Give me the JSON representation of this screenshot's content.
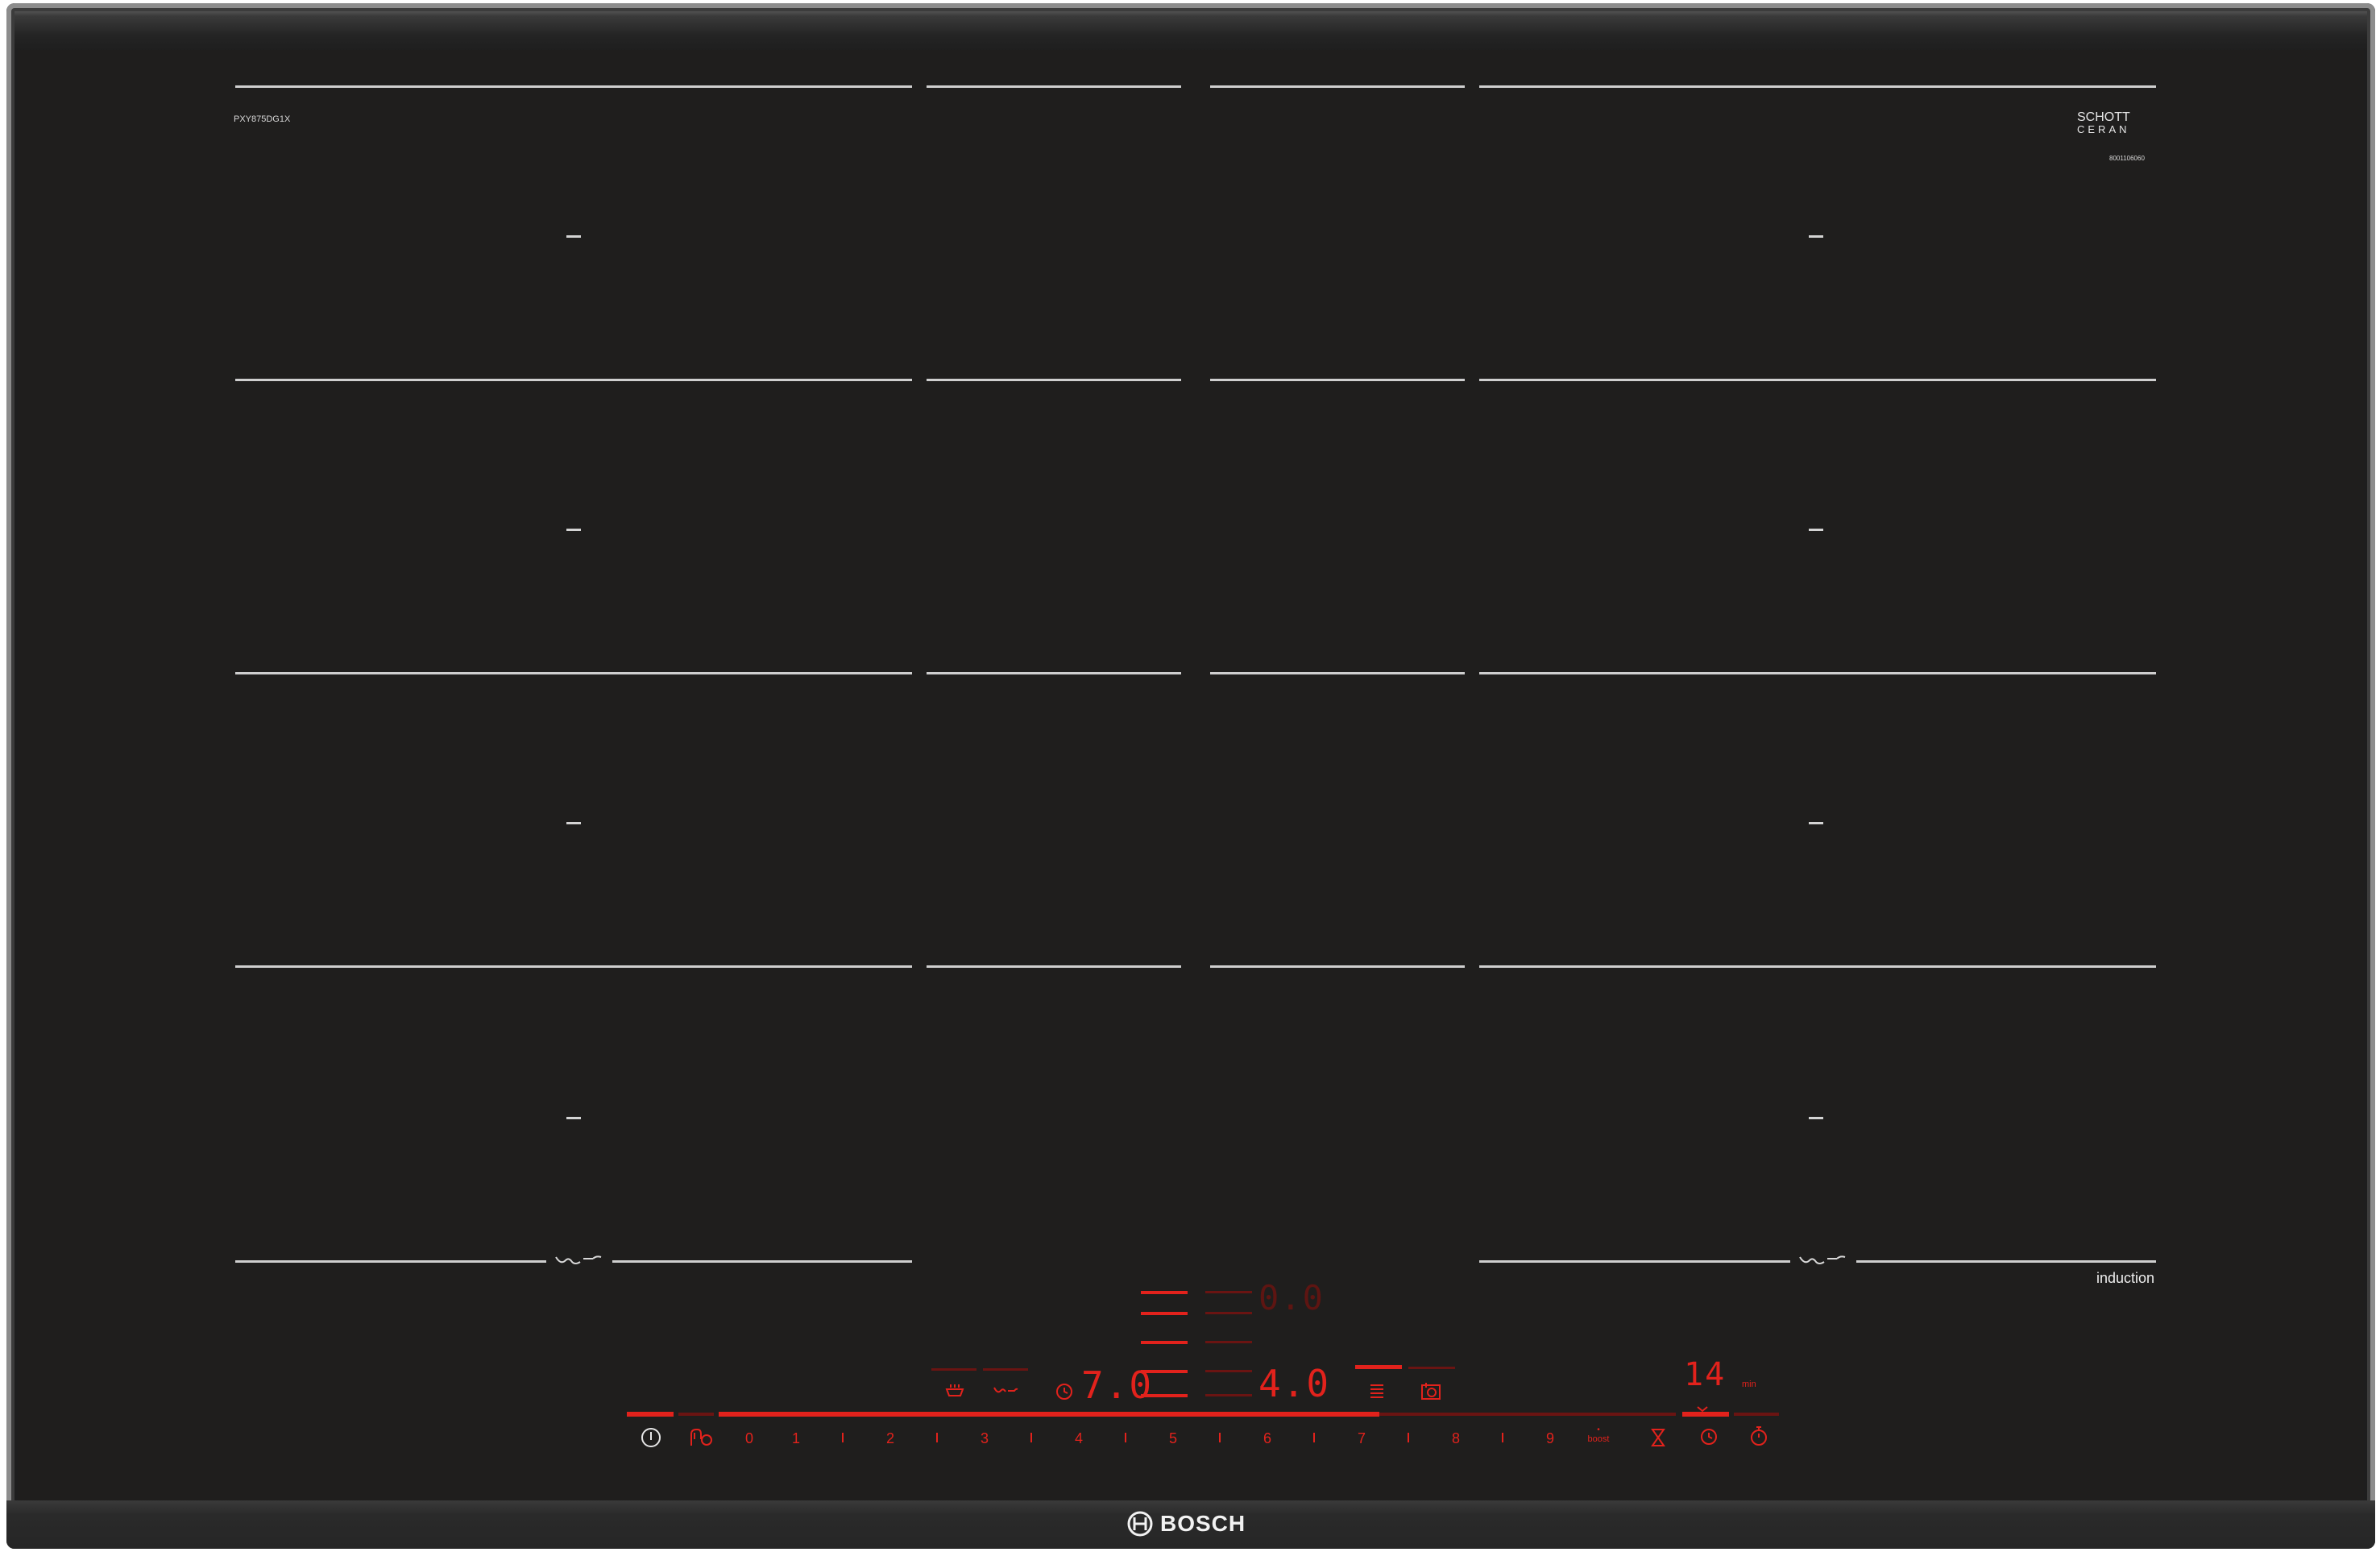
{
  "model_code": "PXY875DG1X",
  "brand_glass": {
    "line1": "SCHOTT",
    "line2": "CERAN",
    "serial": "8001106060"
  },
  "induction_label": "induction",
  "brand": "BOSCH",
  "control": {
    "power_symbol": "power-icon",
    "digits": [
      "0",
      "1",
      "2",
      "3",
      "4",
      "5",
      "6",
      "7",
      "8",
      "9"
    ],
    "boost_label": "boost",
    "left_display": "7.0",
    "center_top_display": "0.0",
    "center_display": "4.0",
    "timer_display": "14",
    "timer_unit": "min"
  },
  "colors": {
    "display_red": "#e2221c",
    "glass": "#1f1e1d",
    "lines": "#cfcfcf"
  }
}
